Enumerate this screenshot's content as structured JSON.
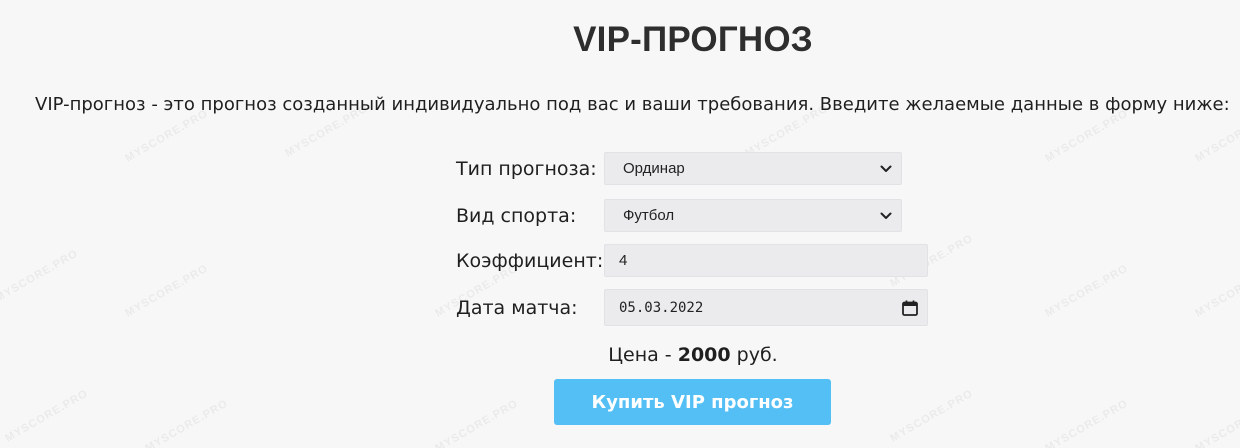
{
  "page": {
    "title": "VIP-ПРОГНОЗ",
    "intro": "VIP-прогноз - это прогноз созданный индивидуально под вас и ваши требования. Введите желаемые данные в форму ниже:"
  },
  "form": {
    "type": {
      "label": "Тип прогноза:",
      "value": "Ординар",
      "icon": "chevron-down-icon"
    },
    "sport": {
      "label": "Вид спорта:",
      "value": "Футбол",
      "icon": "chevron-down-icon"
    },
    "coef": {
      "label": "Коэффициент:",
      "value": "4"
    },
    "date": {
      "label": "Дата матча:",
      "value": "05.03.2022",
      "icon": "calendar-icon"
    }
  },
  "price": {
    "prefix": "Цена - ",
    "amount": "2000",
    "suffix": " руб."
  },
  "buy_button": {
    "label": "Купить VIP прогноз"
  },
  "watermark": {
    "text": "MYSCORE.PRO"
  },
  "colors": {
    "accent": "#54bff5",
    "background": "#f7f7f7",
    "field": "#ebebee"
  }
}
